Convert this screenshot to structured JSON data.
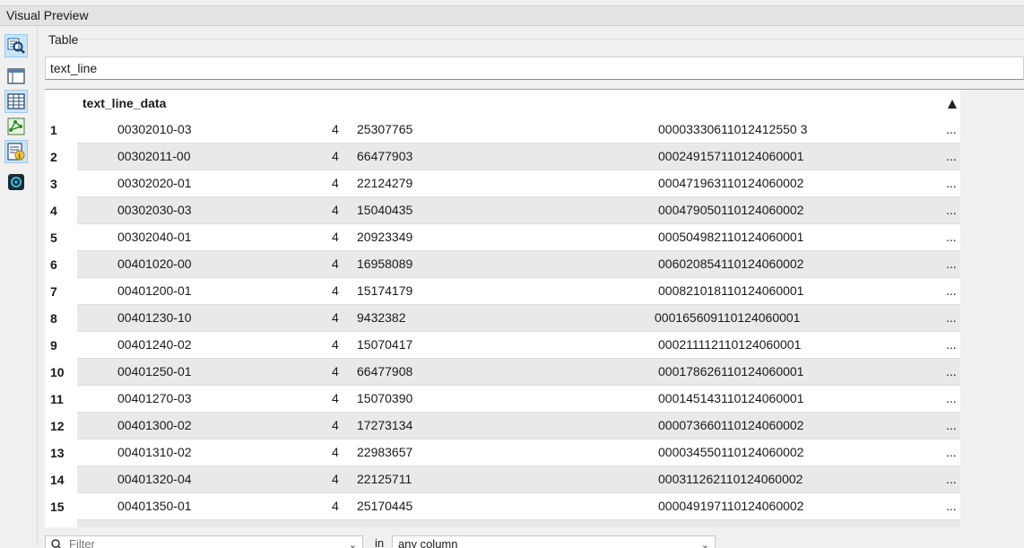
{
  "window": {
    "title": "Visual Preview"
  },
  "sidebar": {
    "buttons": [
      {
        "name": "data-preview-icon",
        "active": true
      },
      {
        "name": "schema-view-icon",
        "active": false
      },
      {
        "name": "table-view-icon",
        "active": true
      },
      {
        "name": "graphics-view-icon",
        "active": false
      },
      {
        "name": "feature-info-icon",
        "active": true
      },
      {
        "name": "map-view-icon",
        "active": false
      }
    ]
  },
  "tab": {
    "label": "Table"
  },
  "dataset": {
    "name": "text_line"
  },
  "table": {
    "column_header": "text_line_data",
    "more_label": "...",
    "rows": [
      {
        "index": "1",
        "code": "00302010-03",
        "type": "4",
        "id": "25307765",
        "uid": "00003330611012412550 3"
      },
      {
        "index": "2",
        "code": "00302011-00",
        "type": "4",
        "id": "66477903",
        "uid": "000249157110124060001"
      },
      {
        "index": "3",
        "code": "00302020-01",
        "type": "4",
        "id": "22124279",
        "uid": "000471963110124060002"
      },
      {
        "index": "4",
        "code": "00302030-03",
        "type": "4",
        "id": "15040435",
        "uid": "000479050110124060002"
      },
      {
        "index": "5",
        "code": "00302040-01",
        "type": "4",
        "id": "20923349",
        "uid": "000504982110124060001"
      },
      {
        "index": "6",
        "code": "00401020-00",
        "type": "4",
        "id": "16958089",
        "uid": "006020854110124060002"
      },
      {
        "index": "7",
        "code": "00401200-01",
        "type": "4",
        "id": "15174179",
        "uid": "000821018110124060001"
      },
      {
        "index": "8",
        "code": "00401230-10",
        "type": "4",
        "id": "9432382",
        "uid": "000165609110124060001"
      },
      {
        "index": "9",
        "code": "00401240-02",
        "type": "4",
        "id": "15070417",
        "uid": "000211112110124060001"
      },
      {
        "index": "10",
        "code": "00401250-01",
        "type": "4",
        "id": "66477908",
        "uid": "000178626110124060001"
      },
      {
        "index": "11",
        "code": "00401270-03",
        "type": "4",
        "id": "15070390",
        "uid": "000145143110124060001"
      },
      {
        "index": "12",
        "code": "00401300-02",
        "type": "4",
        "id": "17273134",
        "uid": "000073660110124060002"
      },
      {
        "index": "13",
        "code": "00401310-02",
        "type": "4",
        "id": "22983657",
        "uid": "000034550110124060002"
      },
      {
        "index": "14",
        "code": "00401320-04",
        "type": "4",
        "id": "22125711",
        "uid": "000311262110124060002"
      },
      {
        "index": "15",
        "code": "00401350-01",
        "type": "4",
        "id": "25170445",
        "uid": "000049197110124060002"
      }
    ]
  },
  "filter": {
    "placeholder": "Filter",
    "in_label": "in",
    "column_value": "any column"
  },
  "colors": {
    "active_button": "#cce4f7",
    "alt_row": "#e9e9e7"
  }
}
